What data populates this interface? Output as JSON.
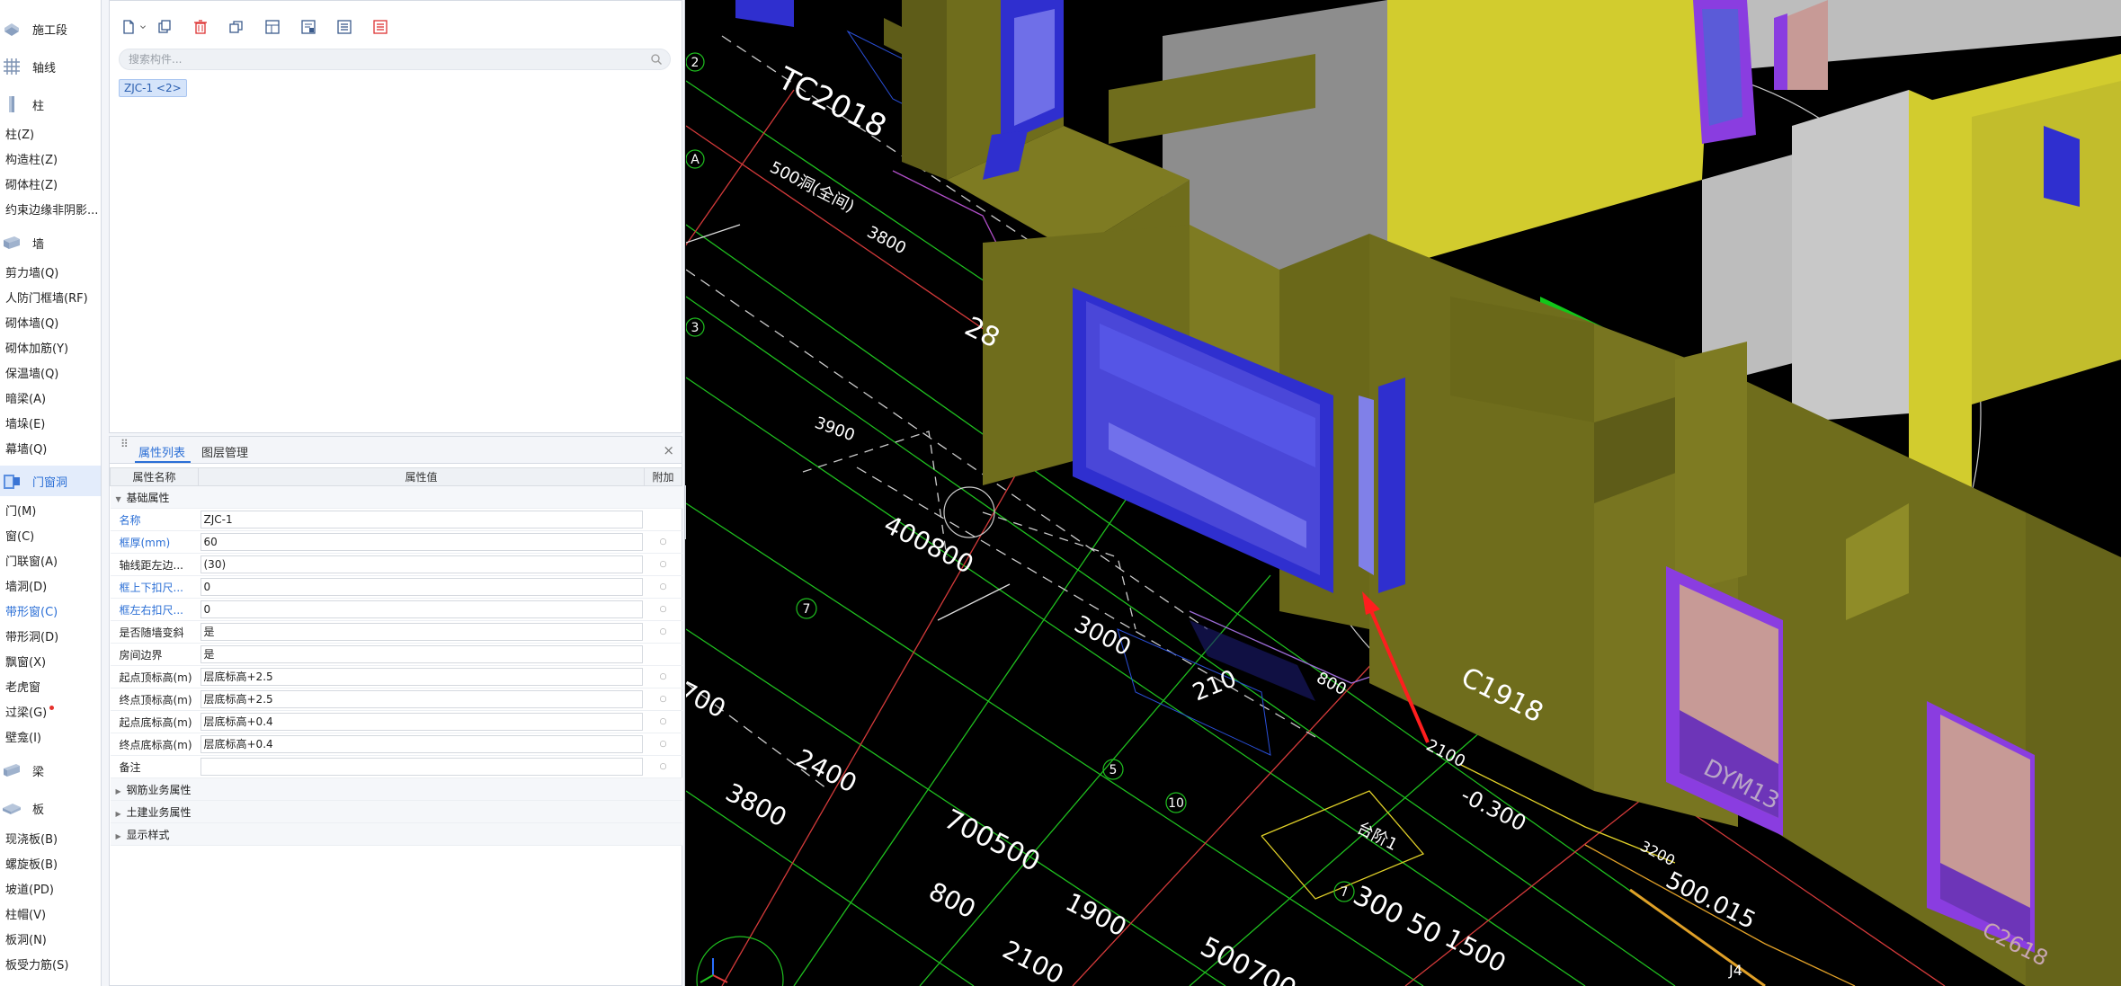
{
  "nav": {
    "categories": [
      {
        "label": "施工段",
        "icon": "construction-segment-icon",
        "active": false
      },
      {
        "label": "轴线",
        "icon": "grid-axis-icon",
        "active": false
      },
      {
        "label": "柱",
        "icon": "column-icon",
        "active": false
      },
      {
        "label": "墙",
        "icon": "wall-icon",
        "active": false
      },
      {
        "label": "门窗洞",
        "icon": "door-window-icon",
        "active": true
      },
      {
        "label": "梁",
        "icon": "beam-icon",
        "active": false
      },
      {
        "label": "板",
        "icon": "slab-icon",
        "active": false
      }
    ],
    "column_items": [
      "柱(Z)",
      "构造柱(Z)",
      "砌体柱(Z)",
      "约束边缘非阴影..."
    ],
    "wall_items": [
      "剪力墙(Q)",
      "人防门框墙(RF)",
      "砌体墙(Q)",
      "砌体加筋(Y)",
      "保温墙(Q)",
      "暗梁(A)",
      "墙垛(E)",
      "幕墙(Q)"
    ],
    "opening_items": [
      "门(M)",
      "窗(C)",
      "门联窗(A)",
      "墙洞(D)",
      "带形窗(C)",
      "带形洞(D)",
      "飘窗(X)",
      "老虎窗",
      "过梁(G)",
      "壁龛(I)"
    ],
    "opening_active_item": "带形窗(C)",
    "slab_items": [
      "现浇板(B)",
      "螺旋板(B)",
      "坡道(PD)",
      "柱帽(V)",
      "板洞(N)",
      "板受力筋(S)"
    ]
  },
  "component_panel": {
    "search": {
      "placeholder": "搜索构件..."
    },
    "selected_chip": "ZJC-1 <2>",
    "toolbar_icons": [
      "new-component-icon",
      "dropdown-arrow-icon",
      "copy-icon",
      "delete-icon",
      "layer-copy-icon",
      "filter-icon",
      "sort-icon",
      "list-icon",
      "property-icon"
    ]
  },
  "property_panel": {
    "tabs": {
      "props": "属性列表",
      "layers": "图层管理"
    },
    "columns": {
      "name": "属性名称",
      "value": "属性值",
      "extra": "附加"
    },
    "group_basic": "基础属性",
    "rows": [
      {
        "name": "名称",
        "value": "ZJC-1",
        "blue": true,
        "extra": false
      },
      {
        "name": "框厚(mm)",
        "value": "60",
        "blue": true,
        "extra": true
      },
      {
        "name": "轴线距左边...",
        "value": "(30)",
        "blue": false,
        "extra": true
      },
      {
        "name": "框上下扣尺...",
        "value": "0",
        "blue": true,
        "extra": true
      },
      {
        "name": "框左右扣尺...",
        "value": "0",
        "blue": true,
        "extra": true
      },
      {
        "name": "是否随墙变斜",
        "value": "是",
        "blue": false,
        "extra": true
      },
      {
        "name": "房间边界",
        "value": "是",
        "blue": false,
        "extra": false
      },
      {
        "name": "起点顶标高(m)",
        "value": "层底标高+2.5",
        "blue": false,
        "extra": true
      },
      {
        "name": "终点顶标高(m)",
        "value": "层底标高+2.5",
        "blue": false,
        "extra": true
      },
      {
        "name": "起点底标高(m)",
        "value": "层底标高+0.4",
        "blue": false,
        "extra": true
      },
      {
        "name": "终点底标高(m)",
        "value": "层底标高+0.4",
        "blue": false,
        "extra": true
      },
      {
        "name": "备注",
        "value": "",
        "blue": false,
        "extra": true
      }
    ],
    "groups_collapsed": [
      "钢筋业务属性",
      "土建业务属性",
      "显示样式"
    ]
  },
  "viewport": {
    "axis_labels": [
      "2",
      "A",
      "3",
      "7",
      "5",
      "10",
      "7"
    ],
    "dimension_labels": [
      "3900",
      "400800",
      "3000",
      "210",
      "800",
      "2100",
      "2400",
      "3800",
      "700500",
      "800",
      "1900",
      "2100",
      "500700",
      "700",
      "-0.300",
      "1500",
      "3200",
      "500.015",
      "3800",
      "300 50",
      "28"
    ],
    "cad_text": [
      "TC2018",
      "C1918",
      "DYM13",
      "500洞(全间)",
      "C2618",
      "台阶1",
      "J4"
    ],
    "colors": {
      "wall_olive": "#6f6d1c",
      "wall_olive_light": "#7e7b22",
      "wall_yellow": "#d2cc2e",
      "wall_grey": "#8d8d8d",
      "wall_grey_light": "#bdbdbd",
      "window_blue": "#2f2fcf",
      "window_purple": "#8a3de0",
      "door_pink": "#c79a96",
      "slab_green": "#12c71a",
      "cad_green": "#1fbf1f",
      "cad_red": "#e33a3a",
      "cad_white": "#dddddd",
      "arrow_red": "#ff1e1e"
    }
  }
}
